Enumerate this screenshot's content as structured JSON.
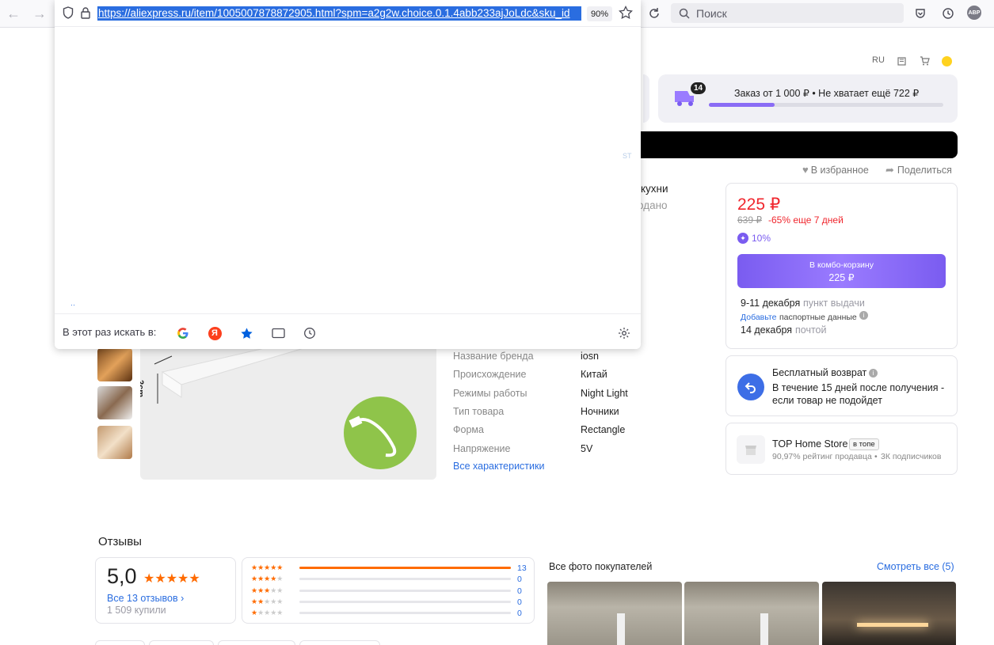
{
  "browser": {
    "url": "https://aliexpress.ru/item/1005007878872905.html?spm=a2g2w.choice.0.1.4abb233ajJoLdc&sku_id",
    "zoom": "90%",
    "search_placeholder": "Поиск",
    "search_with_label": "В этот раз искать в:",
    "abp_label": "ABP",
    "stray_text": "ST"
  },
  "header": {
    "lang": "RU"
  },
  "cart_progress": {
    "badge": "14",
    "text": "Заказ от 1 000 ₽ • Не хватает ещё 722 ₽",
    "progress": 0.28
  },
  "actions": {
    "favorite": "В избранное",
    "share": "Поделиться"
  },
  "title_fragments": {
    "line1": "кухни",
    "line2": "одано"
  },
  "price": {
    "current": "225 ₽",
    "old": "639 ₽",
    "discount": "-65% еще 7 дней",
    "cashback": "10%",
    "combo_label": "В комбо-корзину",
    "combo_price": "225 ₽",
    "delivery1_date": "9-11 декабря",
    "delivery1_type": "пункт выдачи",
    "passport_link": "Добавьте",
    "passport_text": "паспортные данные",
    "delivery2_date": "14 декабря",
    "delivery2_type": "почтой"
  },
  "return_policy": {
    "title": "Бесплатный возврат",
    "text": "В течение 15 дней после получения - если товар не подойдет"
  },
  "store": {
    "name": "TOP Home Store",
    "badge": "в топе",
    "rating": "90,97% рейтинг продавца",
    "subscribers": "3К подписчиков"
  },
  "specs": [
    {
      "name": "Название бренда",
      "value": "iosn"
    },
    {
      "name": "Происхождение",
      "value": "Китай"
    },
    {
      "name": "Режимы работы",
      "value": "Night Light"
    },
    {
      "name": "Тип товара",
      "value": "Ночники"
    },
    {
      "name": "Форма",
      "value": "Rectangle"
    },
    {
      "name": "Напряжение",
      "value": "5V"
    }
  ],
  "specs_link": "Все характеристики",
  "image_label": "2cm",
  "reviews": {
    "heading": "Отзывы",
    "score": "5,0",
    "all_link": "Все 13 отзывов",
    "bought": "1 509 купили",
    "bars": [
      {
        "stars": 5,
        "count": "13",
        "fraction": 1.0
      },
      {
        "stars": 4,
        "count": "0",
        "fraction": 0
      },
      {
        "stars": 3,
        "count": "0",
        "fraction": 0
      },
      {
        "stars": 2,
        "count": "0",
        "fraction": 0
      },
      {
        "stars": 1,
        "count": "0",
        "fraction": 0
      }
    ],
    "photos_title": "Все фото покупателей",
    "photos_link": "Смотреть все (5)"
  },
  "colors": {
    "accent": "#ff6b00",
    "price_red": "#f0262d",
    "purple": "#7a5cf0",
    "link": "#2a6de0"
  }
}
